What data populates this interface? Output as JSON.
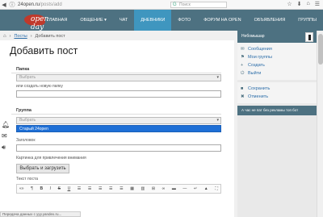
{
  "browser": {
    "url_host": "24open.ru",
    "url_path": "/posts/add",
    "search_placeholder": "Поиск"
  },
  "header": {
    "logo_text": "open day",
    "menu": [
      {
        "label": "Главная"
      },
      {
        "label": "Общение ▾"
      },
      {
        "label": "Чат"
      },
      {
        "label": "Дневники",
        "active": true
      },
      {
        "label": "Фото"
      },
      {
        "label": "Форум на Open"
      },
      {
        "label": "Объявления"
      },
      {
        "label": "Группы"
      }
    ]
  },
  "breadcrumb": {
    "home_icon": "home-icon",
    "link": "Посты",
    "current": "Добавить пост"
  },
  "form": {
    "title": "Добавить пост",
    "folder_section": "Папка",
    "folder_select": "Выбрать",
    "folder_hint": "или создать новую папку",
    "group_section": "Группа",
    "group_select": "Выбрать",
    "group_option": "Старый 24open",
    "heading_label": "Заголовок",
    "image_label": "Картинка для привлечения внимания",
    "upload_button": "Выбрать и загрузить",
    "text_label": "Текст поста"
  },
  "editor_tools": [
    "«»",
    "¶",
    "B",
    "I",
    "S",
    "U",
    "☰",
    "☰",
    "☰",
    "☰",
    "☰",
    "▦",
    "▥",
    "⊞",
    "∞",
    "▬",
    "—",
    "↵",
    "▲",
    "⛶"
  ],
  "sidebar": {
    "username": "Небомышар",
    "items": [
      {
        "icon": "mail-icon",
        "glyph": "✉",
        "label": "Сообщения"
      },
      {
        "icon": "groups-icon",
        "glyph": "⚑",
        "label": "Мои группы"
      },
      {
        "icon": "plus-icon",
        "glyph": "+",
        "label": "Создать"
      },
      {
        "icon": "exit-icon",
        "glyph": "⏻",
        "label": "Выйти"
      }
    ],
    "actions": [
      {
        "icon": "save-icon",
        "glyph": "■",
        "label": "Сохранить"
      },
      {
        "icon": "cancel-icon",
        "glyph": "✖",
        "label": "Отменить"
      }
    ],
    "promo": "А час не пат без рекламы топ бот"
  },
  "status_bar": "Передача данных с yyy.yandex.ru..."
}
